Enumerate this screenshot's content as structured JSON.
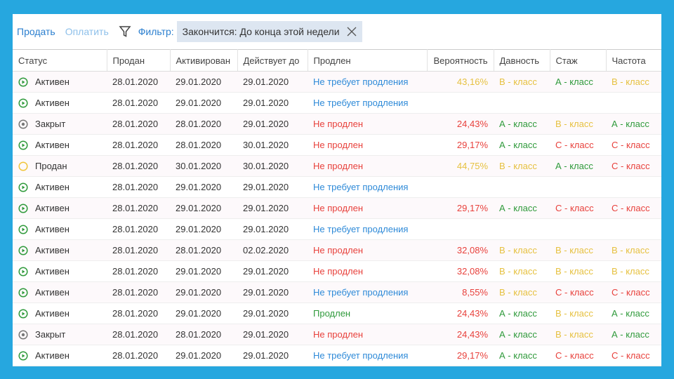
{
  "toolbar": {
    "sell": "Продать",
    "pay": "Оплатить",
    "filter_label": "Фильтр:",
    "filter_chip": "Закончится: До конца этой недели"
  },
  "colors": {
    "blue": "#2e8ad8",
    "red": "#e8413c",
    "green": "#2f9a3b",
    "yellow": "#e6c140",
    "frame": "#26a7df"
  },
  "columns": [
    "Статус",
    "Продан",
    "Активирован",
    "Действует до",
    "Продлен",
    "Вероятность",
    "Давность",
    "Стаж",
    "Частота"
  ],
  "rows": [
    {
      "status": "Активен",
      "icon": "active",
      "sold": "28.01.2020",
      "activated": "29.01.2020",
      "valid": "29.01.2020",
      "renewed": "Не требует продления",
      "rc": "blue",
      "prob": "43,16%",
      "pc": "yellow",
      "d": "В - класс",
      "dc": "yellow",
      "s": "А - класс",
      "sc": "green",
      "f": "В - класс",
      "fc": "yellow"
    },
    {
      "status": "Активен",
      "icon": "active",
      "sold": "28.01.2020",
      "activated": "29.01.2020",
      "valid": "29.01.2020",
      "renewed": "Не требует продления",
      "rc": "blue",
      "prob": "",
      "pc": "",
      "d": "",
      "dc": "",
      "s": "",
      "sc": "",
      "f": "",
      "fc": ""
    },
    {
      "status": "Закрыт",
      "icon": "closed",
      "sold": "28.01.2020",
      "activated": "28.01.2020",
      "valid": "29.01.2020",
      "renewed": "Не продлен",
      "rc": "red",
      "prob": "24,43%",
      "pc": "red",
      "d": "А - класс",
      "dc": "green",
      "s": "В - класс",
      "sc": "yellow",
      "f": "А - класс",
      "fc": "green"
    },
    {
      "status": "Активен",
      "icon": "active",
      "sold": "28.01.2020",
      "activated": "28.01.2020",
      "valid": "30.01.2020",
      "renewed": "Не продлен",
      "rc": "red",
      "prob": "29,17%",
      "pc": "red",
      "d": "А - класс",
      "dc": "green",
      "s": "С - класс",
      "sc": "red",
      "f": "С - класс",
      "fc": "red"
    },
    {
      "status": "Продан",
      "icon": "sold",
      "sold": "28.01.2020",
      "activated": "30.01.2020",
      "valid": "30.01.2020",
      "renewed": "Не продлен",
      "rc": "red",
      "prob": "44,75%",
      "pc": "yellow",
      "d": "В - класс",
      "dc": "yellow",
      "s": "А - класс",
      "sc": "green",
      "f": "С - класс",
      "fc": "red"
    },
    {
      "status": "Активен",
      "icon": "active",
      "sold": "28.01.2020",
      "activated": "29.01.2020",
      "valid": "29.01.2020",
      "renewed": "Не требует продления",
      "rc": "blue",
      "prob": "",
      "pc": "",
      "d": "",
      "dc": "",
      "s": "",
      "sc": "",
      "f": "",
      "fc": ""
    },
    {
      "status": "Активен",
      "icon": "active",
      "sold": "28.01.2020",
      "activated": "29.01.2020",
      "valid": "29.01.2020",
      "renewed": "Не продлен",
      "rc": "red",
      "prob": "29,17%",
      "pc": "red",
      "d": "А - класс",
      "dc": "green",
      "s": "С - класс",
      "sc": "red",
      "f": "С - класс",
      "fc": "red"
    },
    {
      "status": "Активен",
      "icon": "active",
      "sold": "28.01.2020",
      "activated": "29.01.2020",
      "valid": "29.01.2020",
      "renewed": "Не требует продления",
      "rc": "blue",
      "prob": "",
      "pc": "",
      "d": "",
      "dc": "",
      "s": "",
      "sc": "",
      "f": "",
      "fc": ""
    },
    {
      "status": "Активен",
      "icon": "active",
      "sold": "28.01.2020",
      "activated": "28.01.2020",
      "valid": "02.02.2020",
      "renewed": "Не продлен",
      "rc": "red",
      "prob": "32,08%",
      "pc": "red",
      "d": "В - класс",
      "dc": "yellow",
      "s": "В - класс",
      "sc": "yellow",
      "f": "В - класс",
      "fc": "yellow"
    },
    {
      "status": "Активен",
      "icon": "active",
      "sold": "28.01.2020",
      "activated": "29.01.2020",
      "valid": "29.01.2020",
      "renewed": "Не продлен",
      "rc": "red",
      "prob": "32,08%",
      "pc": "red",
      "d": "В - класс",
      "dc": "yellow",
      "s": "В - класс",
      "sc": "yellow",
      "f": "В - класс",
      "fc": "yellow"
    },
    {
      "status": "Активен",
      "icon": "active",
      "sold": "28.01.2020",
      "activated": "29.01.2020",
      "valid": "29.01.2020",
      "renewed": "Не требует продления",
      "rc": "blue",
      "prob": "8,55%",
      "pc": "red",
      "d": "В - класс",
      "dc": "yellow",
      "s": "С - класс",
      "sc": "red",
      "f": "С - класс",
      "fc": "red"
    },
    {
      "status": "Активен",
      "icon": "active",
      "sold": "28.01.2020",
      "activated": "29.01.2020",
      "valid": "29.01.2020",
      "renewed": "Продлен",
      "rc": "green",
      "prob": "24,43%",
      "pc": "red",
      "d": "А - класс",
      "dc": "green",
      "s": "В - класс",
      "sc": "yellow",
      "f": "А - класс",
      "fc": "green"
    },
    {
      "status": "Закрыт",
      "icon": "closed",
      "sold": "28.01.2020",
      "activated": "28.01.2020",
      "valid": "29.01.2020",
      "renewed": "Не продлен",
      "rc": "red",
      "prob": "24,43%",
      "pc": "red",
      "d": "А - класс",
      "dc": "green",
      "s": "В - класс",
      "sc": "yellow",
      "f": "А - класс",
      "fc": "green"
    },
    {
      "status": "Активен",
      "icon": "active",
      "sold": "28.01.2020",
      "activated": "29.01.2020",
      "valid": "29.01.2020",
      "renewed": "Не требует продления",
      "rc": "blue",
      "prob": "29,17%",
      "pc": "red",
      "d": "А - класс",
      "dc": "green",
      "s": "С - класс",
      "sc": "red",
      "f": "С - класс",
      "fc": "red"
    }
  ]
}
